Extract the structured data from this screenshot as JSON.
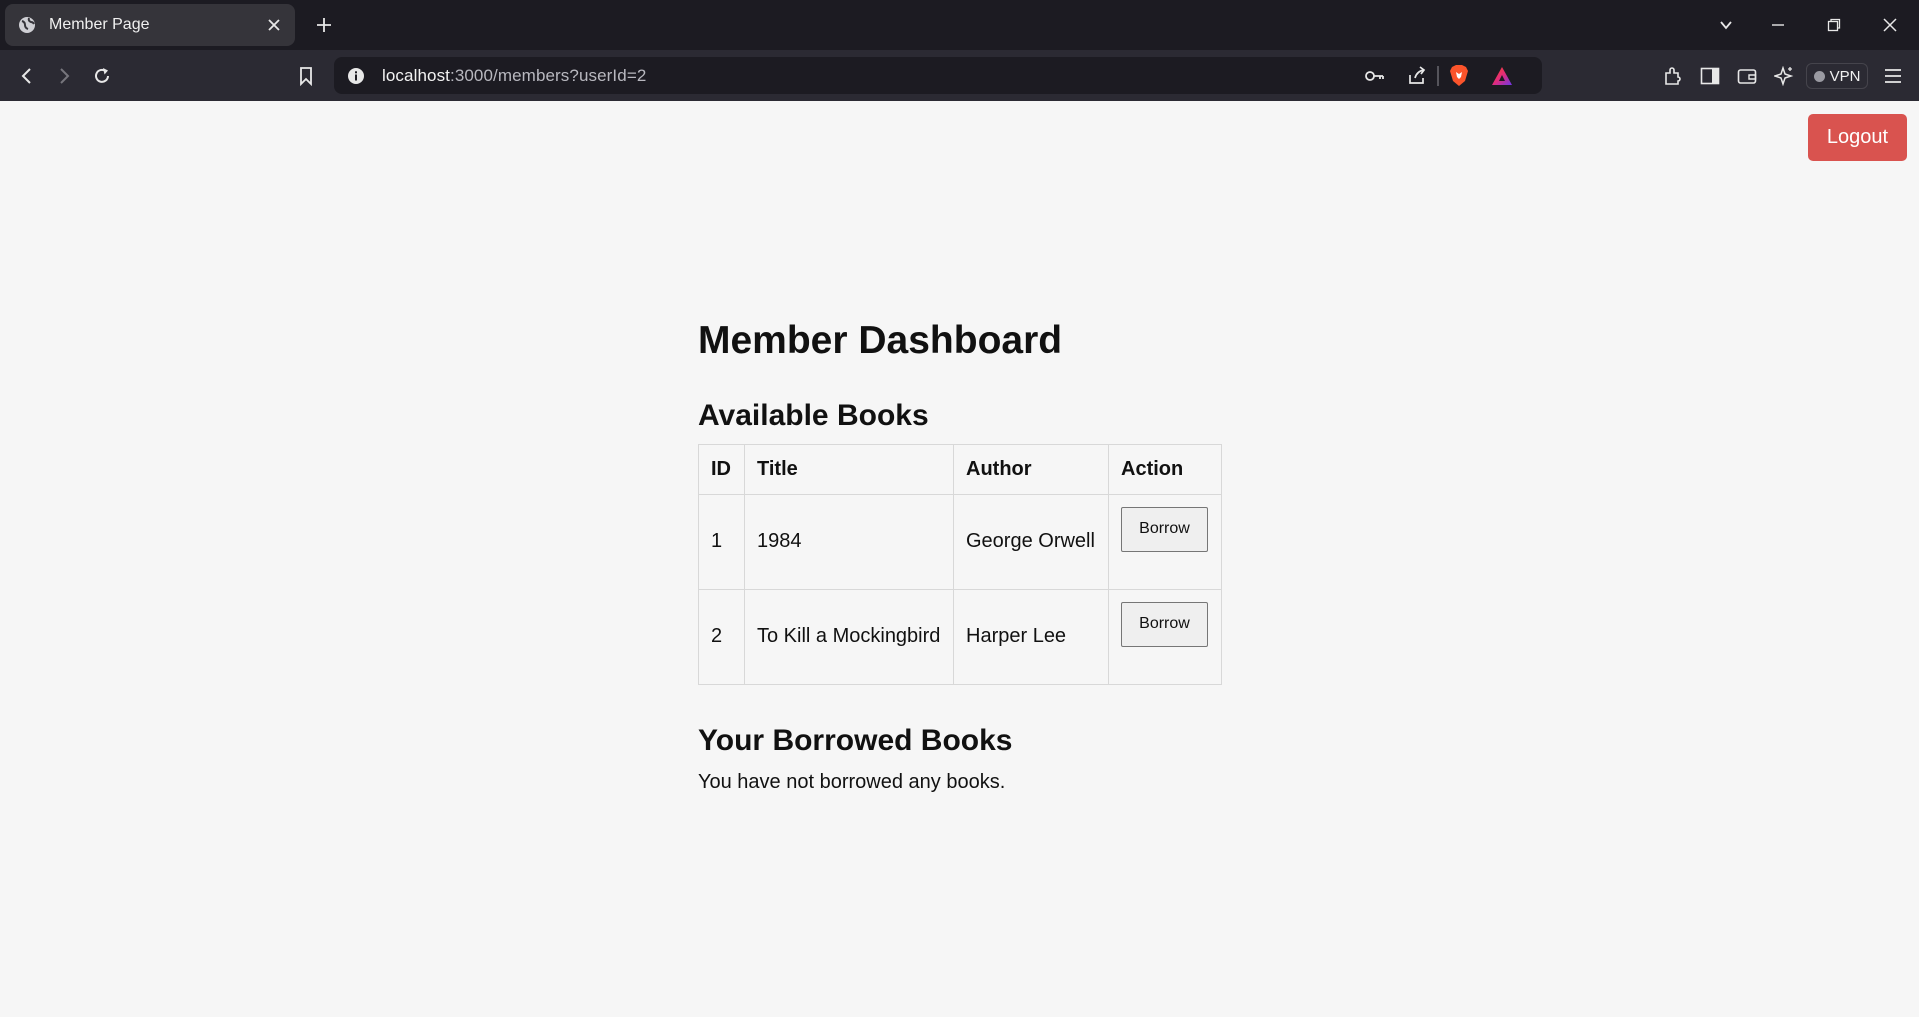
{
  "browser": {
    "tab_title": "Member Page",
    "url_host": "localhost",
    "url_rest": ":3000/members?userId=2",
    "vpn_label": "VPN",
    "icons": [
      "globe-icon",
      "close-icon",
      "plus-icon",
      "chevron-down-icon",
      "minimize-icon",
      "restore-icon",
      "window-close-icon",
      "back-icon",
      "forward-icon",
      "reload-icon",
      "bookmark-icon",
      "info-icon",
      "key-icon",
      "share-icon",
      "brave-shield-icon",
      "brave-rewards-icon",
      "extensions-icon",
      "sidebar-icon",
      "wallet-icon",
      "leo-ai-icon",
      "menu-icon"
    ]
  },
  "page": {
    "logout_label": "Logout",
    "heading": "Member Dashboard",
    "available_heading": "Available Books",
    "table": {
      "headers": [
        "ID",
        "Title",
        "Author",
        "Action"
      ],
      "rows": [
        {
          "id": "1",
          "title": "1984",
          "author": "George Orwell",
          "action": "Borrow"
        },
        {
          "id": "2",
          "title": "To Kill a Mockingbird",
          "author": "Harper Lee",
          "action": "Borrow"
        }
      ]
    },
    "borrowed_heading": "Your Borrowed Books",
    "borrowed_empty": "You have not borrowed any books."
  },
  "colors": {
    "logout_bg": "#d9534f",
    "page_bg": "#f6f6f6",
    "chrome_bg": "#1c1b22",
    "toolbar_bg": "#2b2a33"
  }
}
